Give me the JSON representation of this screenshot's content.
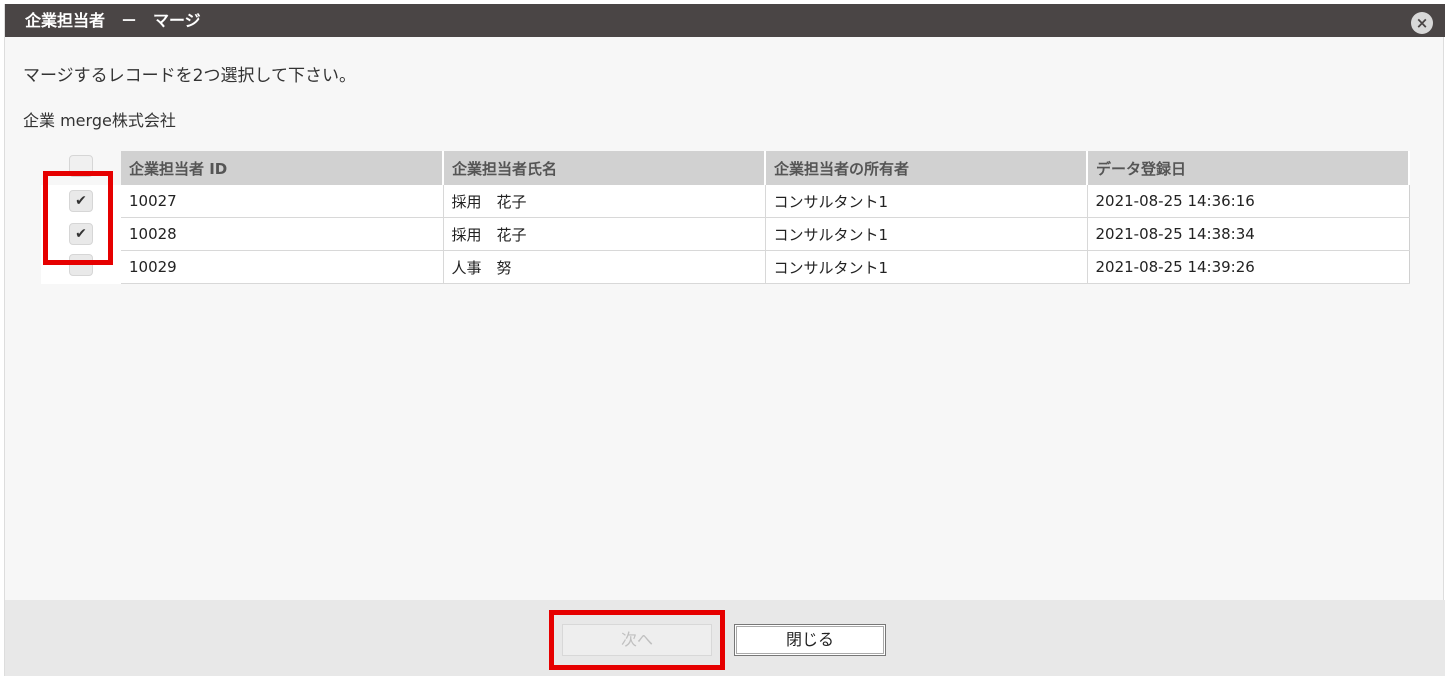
{
  "dialog": {
    "title": "企業担当者　－　マージ",
    "close_icon": "×"
  },
  "instruction": "マージするレコードを2つ選択して下さい。",
  "company_line": "企業 merge株式会社",
  "table": {
    "headers": [
      "企業担当者 ID",
      "企業担当者氏名",
      "企業担当者の所有者",
      "データ登録日"
    ],
    "rows": [
      {
        "checked": true,
        "check_mark": "✔",
        "id": "10027",
        "name": "採用　花子",
        "owner": "コンサルタント1",
        "date": "2021-08-25 14:36:16"
      },
      {
        "checked": true,
        "check_mark": "✔",
        "id": "10028",
        "name": "採用　花子",
        "owner": "コンサルタント1",
        "date": "2021-08-25 14:38:34"
      },
      {
        "checked": false,
        "check_mark": "",
        "id": "10029",
        "name": "人事　努",
        "owner": "コンサルタント1",
        "date": "2021-08-25 14:39:26"
      }
    ]
  },
  "footer": {
    "next_label": "次へ",
    "close_label": "閉じる"
  },
  "colors": {
    "titlebar": "#4a4545",
    "highlight": "#e60000"
  }
}
